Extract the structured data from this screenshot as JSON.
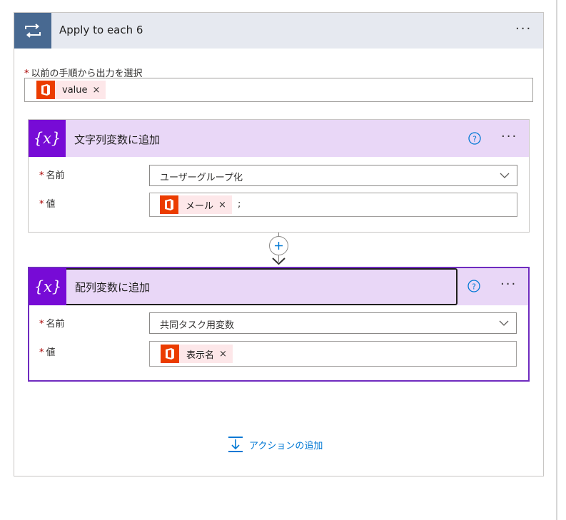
{
  "apply_each": {
    "title": "Apply to each 6",
    "more_label": "···",
    "select_output_label": "以前の手順から出力を選択",
    "token": {
      "label": "value",
      "remove": "×"
    }
  },
  "append_string": {
    "title": "文字列変数に追加",
    "more_label": "···",
    "name_label": "名前",
    "name_value": "ユーザーグループ化",
    "value_label": "値",
    "token": {
      "label": "メール",
      "remove": "×"
    },
    "value_suffix": ";"
  },
  "append_array": {
    "title": "配列変数に追加",
    "more_label": "···",
    "name_label": "名前",
    "name_value": "共同タスク用変数",
    "value_label": "値",
    "token": {
      "label": "表示名",
      "remove": "×"
    }
  },
  "required_marker": "*",
  "add_action_label": "アクションの追加",
  "icons": {
    "loop": "loop-icon",
    "variable": "variable-icon",
    "office": "office-icon",
    "help": "help-icon",
    "chevron": "chevron-down-icon",
    "plus": "plus-icon",
    "add_action": "add-action-icon"
  },
  "colors": {
    "loop_header": "#486991",
    "variable_header": "#770bd6",
    "variable_header_bg": "#e9d7f7",
    "office": "#eb3c00",
    "token_bg": "#fde7e9",
    "link": "#0078d4",
    "selected_border": "#6f2bbf"
  }
}
